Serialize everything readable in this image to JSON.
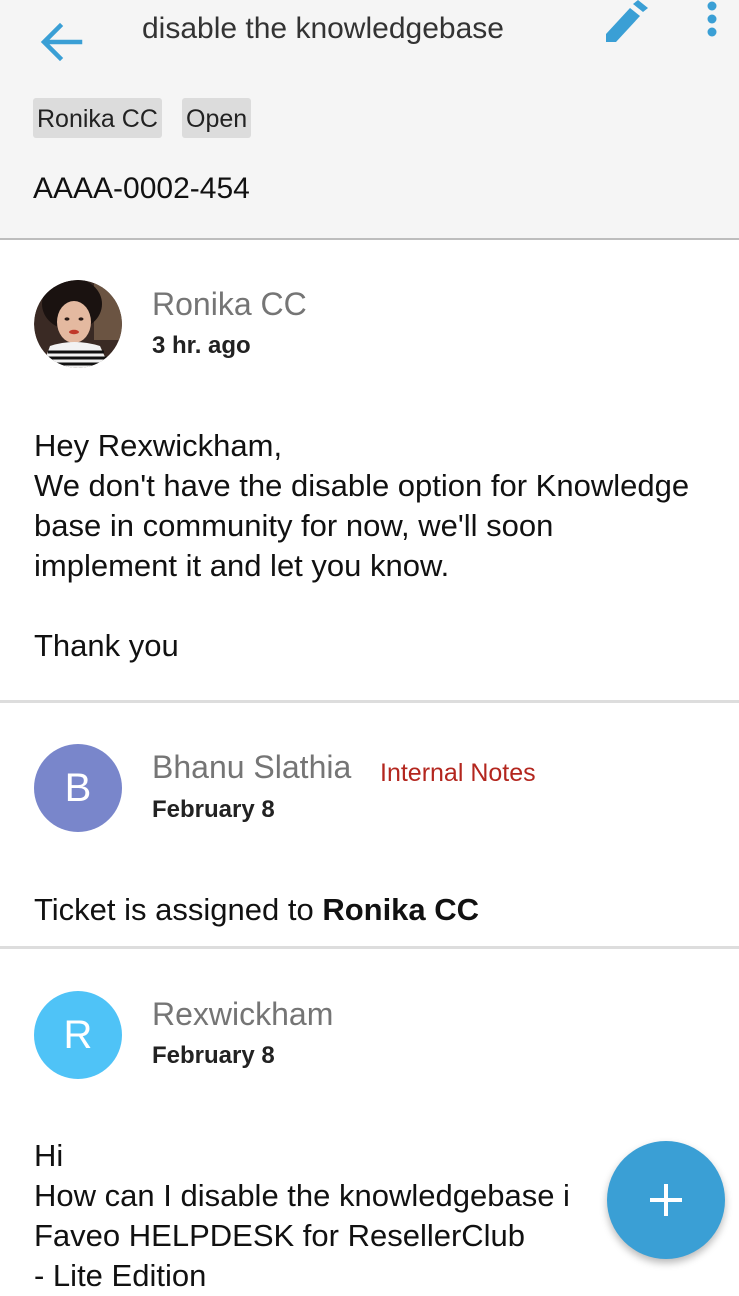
{
  "header": {
    "title": "disable the knowledgebase",
    "assignee_chip": "Ronika CC",
    "status_chip": "Open",
    "ticket_number": "AAAA-0002-454",
    "back_icon": "arrow-back-icon",
    "edit_icon": "pencil-icon",
    "more_icon": "more-vertical-icon"
  },
  "threads": [
    {
      "author": "Ronika CC",
      "time": "3 hr. ago",
      "lines": [
        "Hey Rexwickham,",
        "We don't have the disable option for Knowledge",
        "base in community for now, we'll soon",
        "implement it and let you know.",
        "",
        "Thank you"
      ]
    },
    {
      "author": "Bhanu Slathia",
      "tag": "Internal Notes",
      "time": "February 8",
      "avatar_letter": "B",
      "avatar_color": "#7986cb",
      "body_prefix": "Ticket is assigned to ",
      "body_bold": "Ronika CC"
    },
    {
      "author": "Rexwickham",
      "time": "February 8",
      "avatar_letter": "R",
      "avatar_color": "#4fc3f7",
      "lines": [
        "Hi",
        "How can I disable the knowledgebase i",
        "Faveo HELPDESK for ResellerClub",
        "- Lite Edition"
      ]
    }
  ],
  "fab": {
    "icon": "plus-icon"
  },
  "colors": {
    "accent": "#3a9fd5",
    "tag": "#b3261e",
    "header_bg": "#f5f5f5"
  }
}
